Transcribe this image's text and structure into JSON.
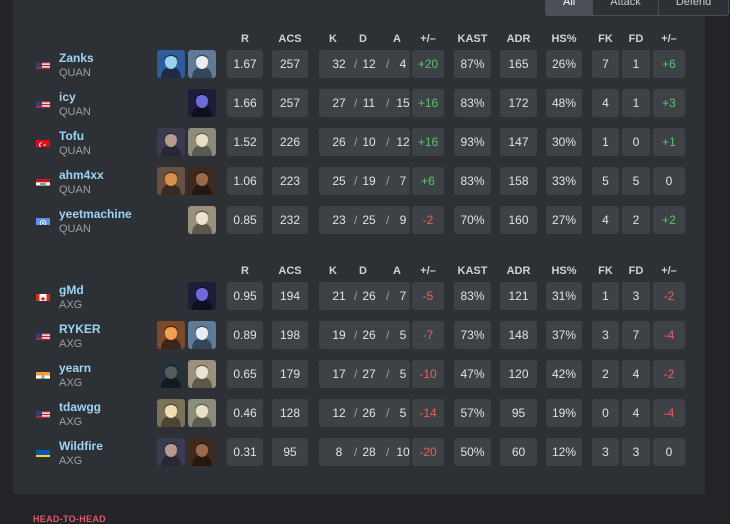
{
  "filters": [
    {
      "label": "All",
      "active": true
    },
    {
      "label": "Attack",
      "active": false
    },
    {
      "label": "Defend",
      "active": false
    }
  ],
  "headers": [
    "R",
    "ACS",
    "K",
    "D",
    "A",
    "+/–",
    "KAST",
    "ADR",
    "HS%",
    "FK",
    "FD",
    "+/–"
  ],
  "teams": [
    {
      "players": [
        {
          "name": "Zanks",
          "team": "QUAN",
          "flag": "us",
          "agents": [
            "sage-portrait-icon",
            "jett-portrait-icon"
          ],
          "r": "1.67",
          "acs": "257",
          "k": "32",
          "d": "12",
          "a": "4",
          "pm": "+20",
          "kast": "87%",
          "adr": "165",
          "hs": "26%",
          "fk": "7",
          "fd": "1",
          "fpm": "+6"
        },
        {
          "name": "icy",
          "team": "QUAN",
          "flag": "us",
          "agents": [
            "omen-portrait-icon"
          ],
          "r": "1.66",
          "acs": "257",
          "k": "27",
          "d": "11",
          "a": "15",
          "pm": "+16",
          "kast": "83%",
          "adr": "172",
          "hs": "48%",
          "fk": "4",
          "fd": "1",
          "fpm": "+3"
        },
        {
          "name": "Tofu",
          "team": "QUAN",
          "flag": "tr",
          "agents": [
            "astra-portrait-icon",
            "sova-portrait-icon"
          ],
          "r": "1.52",
          "acs": "226",
          "k": "26",
          "d": "10",
          "a": "12",
          "pm": "+16",
          "kast": "93%",
          "adr": "147",
          "hs": "30%",
          "fk": "1",
          "fd": "0",
          "fpm": "+1"
        },
        {
          "name": "ahm4xx",
          "team": "QUAN",
          "flag": "iq",
          "agents": [
            "breach-portrait-icon",
            "phoenix-portrait-icon"
          ],
          "r": "1.06",
          "acs": "223",
          "k": "25",
          "d": "19",
          "a": "7",
          "pm": "+6",
          "kast": "83%",
          "adr": "158",
          "hs": "33%",
          "fk": "5",
          "fd": "5",
          "fpm": "0"
        },
        {
          "name": "yeetmachine",
          "team": "QUAN",
          "flag": "un",
          "agents": [
            "cypher-portrait-icon"
          ],
          "r": "0.85",
          "acs": "232",
          "k": "23",
          "d": "25",
          "a": "9",
          "pm": "-2",
          "kast": "70%",
          "adr": "160",
          "hs": "27%",
          "fk": "4",
          "fd": "2",
          "fpm": "+2"
        }
      ]
    },
    {
      "players": [
        {
          "name": "gMd",
          "team": "AXG",
          "flag": "ca",
          "agents": [
            "omen-portrait-icon"
          ],
          "r": "0.95",
          "acs": "194",
          "k": "21",
          "d": "26",
          "a": "7",
          "pm": "-5",
          "kast": "83%",
          "adr": "121",
          "hs": "31%",
          "fk": "1",
          "fd": "3",
          "fpm": "-2"
        },
        {
          "name": "RYKER",
          "team": "AXG",
          "flag": "us",
          "agents": [
            "kayo-portrait-icon",
            "jett-portrait-icon"
          ],
          "r": "0.89",
          "acs": "198",
          "k": "19",
          "d": "26",
          "a": "5",
          "pm": "-7",
          "kast": "73%",
          "adr": "148",
          "hs": "37%",
          "fk": "3",
          "fd": "7",
          "fpm": "-4"
        },
        {
          "name": "yearn",
          "team": "AXG",
          "flag": "in",
          "agents": [
            "viper-portrait-icon",
            "cypher-portrait-icon"
          ],
          "r": "0.65",
          "acs": "179",
          "k": "17",
          "d": "27",
          "a": "5",
          "pm": "-10",
          "kast": "47%",
          "adr": "120",
          "hs": "42%",
          "fk": "2",
          "fd": "4",
          "fpm": "-2"
        },
        {
          "name": "tdawgg",
          "team": "AXG",
          "flag": "us",
          "agents": [
            "skye-portrait-icon",
            "sova-portrait-icon"
          ],
          "r": "0.46",
          "acs": "128",
          "k": "12",
          "d": "26",
          "a": "5",
          "pm": "-14",
          "kast": "57%",
          "adr": "95",
          "hs": "19%",
          "fk": "0",
          "fd": "4",
          "fpm": "-4"
        },
        {
          "name": "Wildfire",
          "team": "AXG",
          "flag": "ua",
          "agents": [
            "astra-portrait-icon",
            "phoenix-portrait-icon"
          ],
          "r": "0.31",
          "acs": "95",
          "k": "8",
          "d": "28",
          "a": "10",
          "pm": "-20",
          "kast": "50%",
          "adr": "60",
          "hs": "12%",
          "fk": "3",
          "fd": "3",
          "fpm": "0"
        }
      ]
    }
  ],
  "footer_label": "HEAD-TO-HEAD",
  "colors": {
    "positive": "#5cc46b",
    "negative": "#ef5e5e",
    "player_link": "#9fd3f5",
    "cell_bg": "#3e4246",
    "panel_bg": "#2d3135"
  }
}
